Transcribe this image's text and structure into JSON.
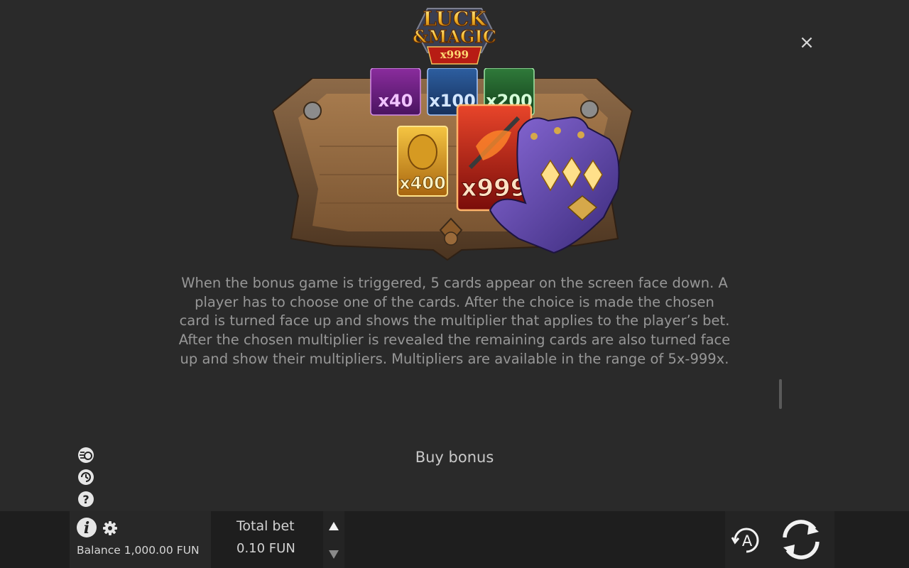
{
  "header": {
    "logo_line1": "LUCK",
    "logo_line2": "&MAGIC",
    "logo_badge": "x999",
    "close_symbol": "×"
  },
  "illustration": {
    "cards": [
      "x40",
      "x100",
      "x200",
      "x400",
      "x999"
    ]
  },
  "description": "When the bonus game is triggered, 5 cards appear on the screen face down. A player has to choose one of the cards. After the choice is made the chosen card is turned face up and shows the multiplier that applies to the player’s bet. After the chosen multiplier is revealed the remaining cards are also turned face up and show their multipliers. Multipliers are available in the range of 5x-999x.",
  "next_section_title": "Buy bonus",
  "side_icons": [
    "turbo-spin-icon",
    "autoplay-settings-icon",
    "help-icon"
  ],
  "footer": {
    "balance": "Balance 1,000.00 FUN",
    "bet_label": "Total bet",
    "bet_value": "0.10 FUN",
    "auto_label": "A"
  },
  "colors": {
    "background": "#2a2a2a",
    "bar": "#1e1e1e",
    "text": "#979797",
    "gold": "#f2b731",
    "accent_red": "#c8221a"
  }
}
